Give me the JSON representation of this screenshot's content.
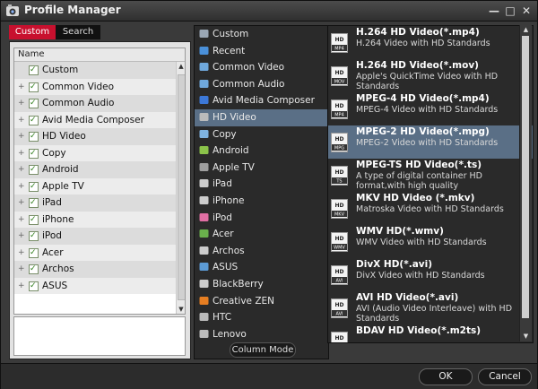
{
  "window": {
    "title": "Profile Manager",
    "minimize": "—",
    "maximize": "□",
    "close": "✕"
  },
  "tabs": {
    "custom": "Custom",
    "search": "Search"
  },
  "tree": {
    "header": "Name",
    "items": [
      {
        "label": "Custom",
        "expand": ""
      },
      {
        "label": "Common Video",
        "expand": "+"
      },
      {
        "label": "Common Audio",
        "expand": "+"
      },
      {
        "label": "Avid Media Composer",
        "expand": "+"
      },
      {
        "label": "HD Video",
        "expand": "+"
      },
      {
        "label": "Copy",
        "expand": "+"
      },
      {
        "label": "Android",
        "expand": "+"
      },
      {
        "label": "Apple TV",
        "expand": "+"
      },
      {
        "label": "iPad",
        "expand": "+"
      },
      {
        "label": "iPhone",
        "expand": "+"
      },
      {
        "label": "iPod",
        "expand": "+"
      },
      {
        "label": "Acer",
        "expand": "+"
      },
      {
        "label": "Archos",
        "expand": "+"
      },
      {
        "label": "ASUS",
        "expand": "+"
      }
    ]
  },
  "categories": [
    {
      "label": "Custom",
      "icon": "gear-icon",
      "color": "#9aa7b5"
    },
    {
      "label": "Recent",
      "icon": "recent-icon",
      "color": "#4a90d9"
    },
    {
      "label": "Common Video",
      "icon": "video-icon",
      "color": "#6fa8dc"
    },
    {
      "label": "Common Audio",
      "icon": "audio-icon",
      "color": "#6fa8dc"
    },
    {
      "label": "Avid Media Composer",
      "icon": "avid-icon",
      "color": "#3c78d8"
    },
    {
      "label": "HD Video",
      "icon": "hd-icon",
      "color": "#bbbbbb",
      "selected": true
    },
    {
      "label": "Copy",
      "icon": "copy-icon",
      "color": "#7fb3e0"
    },
    {
      "label": "Android",
      "icon": "android-icon",
      "color": "#8bc34a"
    },
    {
      "label": "Apple TV",
      "icon": "apple-tv-icon",
      "color": "#9e9e9e"
    },
    {
      "label": "iPad",
      "icon": "ipad-icon",
      "color": "#cccccc"
    },
    {
      "label": "iPhone",
      "icon": "iphone-icon",
      "color": "#cccccc"
    },
    {
      "label": "iPod",
      "icon": "ipod-icon",
      "color": "#e06fa3"
    },
    {
      "label": "Acer",
      "icon": "acer-icon",
      "color": "#6ab04c"
    },
    {
      "label": "Archos",
      "icon": "archos-icon",
      "color": "#cccccc"
    },
    {
      "label": "ASUS",
      "icon": "asus-icon",
      "color": "#5c9bd6"
    },
    {
      "label": "BlackBerry",
      "icon": "blackberry-icon",
      "color": "#cccccc"
    },
    {
      "label": "Creative ZEN",
      "icon": "creative-zen-icon",
      "color": "#e67e22"
    },
    {
      "label": "HTC",
      "icon": "htc-icon",
      "color": "#bbbbbb"
    },
    {
      "label": "Lenovo",
      "icon": "lenovo-icon",
      "color": "#bbbbbb"
    }
  ],
  "column_mode": "Column Mode",
  "formats": [
    {
      "title": "H.264 HD Video(*.mp4)",
      "desc": "H.264 Video with HD Standards",
      "badge": "MP4"
    },
    {
      "title": "H.264 HD Video(*.mov)",
      "desc": "Apple's QuickTime Video with HD Standards",
      "badge": "MOV"
    },
    {
      "title": "MPEG-4 HD Video(*.mp4)",
      "desc": "MPEG-4 Video with HD Standards",
      "badge": "MP4"
    },
    {
      "title": "MPEG-2 HD Video(*.mpg)",
      "desc": "MPEG-2 Video with HD Standards",
      "badge": "MPG",
      "selected": true
    },
    {
      "title": "MPEG-TS HD Video(*.ts)",
      "desc": "A type of digital container HD format,with high quality",
      "badge": "TS"
    },
    {
      "title": "MKV HD Video (*.mkv)",
      "desc": "Matroska Video with HD Standards",
      "badge": "MKV"
    },
    {
      "title": "WMV HD(*.wmv)",
      "desc": "WMV Video with HD Standards",
      "badge": "WMV"
    },
    {
      "title": "DivX HD(*.avi)",
      "desc": "DivX Video with HD Standards",
      "badge": "AVI"
    },
    {
      "title": "AVI HD Video(*.avi)",
      "desc": "AVI (Audio Video Interleave) with HD Standards",
      "badge": "AVI"
    },
    {
      "title": "BDAV HD Video(*.m2ts)",
      "desc": "",
      "badge": ""
    }
  ],
  "buttons": {
    "ok": "OK",
    "cancel": "Cancel"
  },
  "colors": {
    "selection": "#5a6f86",
    "accent": "#c8102e"
  }
}
